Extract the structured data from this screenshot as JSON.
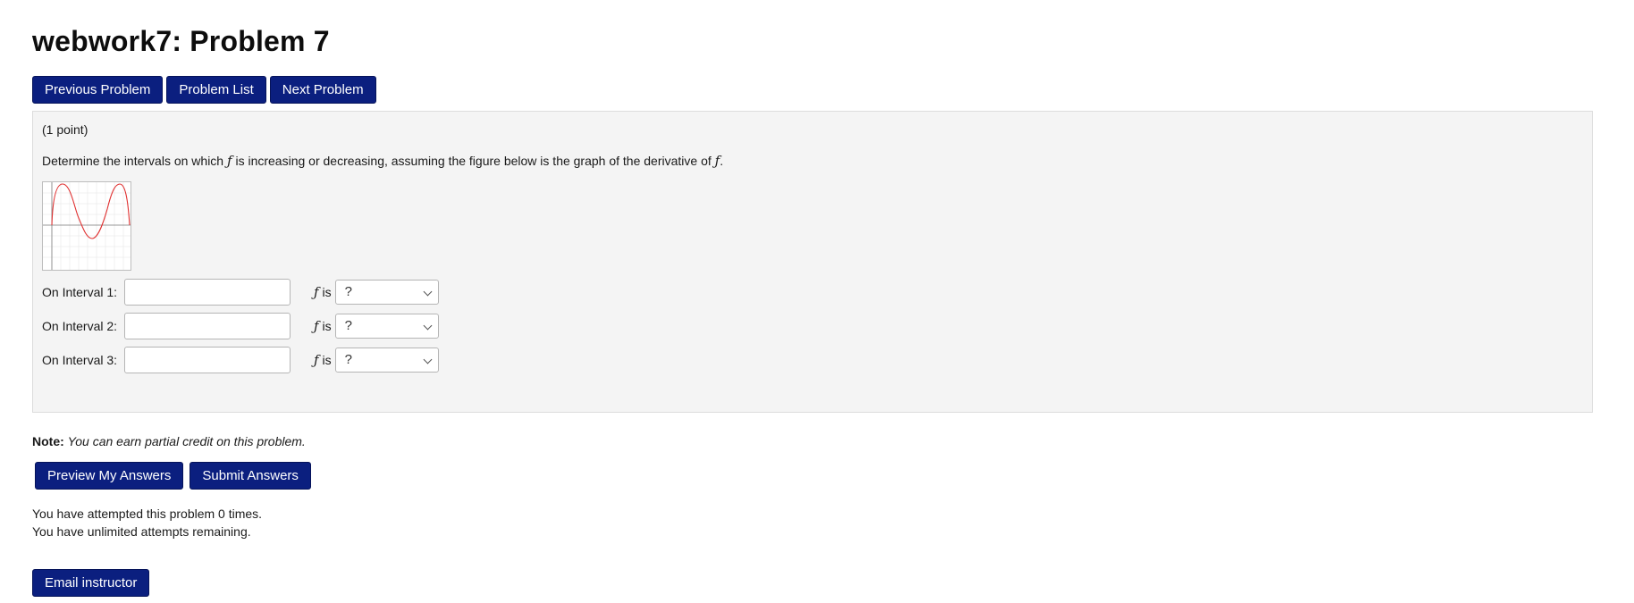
{
  "page": {
    "title": "webwork7: Problem 7"
  },
  "nav": {
    "previous": "Previous Problem",
    "list": "Problem List",
    "next": "Next Problem"
  },
  "problem": {
    "points": "(1 point)",
    "question_pre": "Determine the intervals on which ",
    "question_mid": " is increasing or decreasing, assuming the figure below is the graph of the derivative of ",
    "question_end": ".",
    "f_symbol": "ƒ",
    "f_is": "is",
    "graph_icon": "derivative-graph",
    "curve_color": "#e03030",
    "intervals": [
      {
        "label": "On Interval 1:",
        "value": "",
        "select": "?"
      },
      {
        "label": "On Interval 2:",
        "value": "",
        "select": "?"
      },
      {
        "label": "On Interval 3:",
        "value": "",
        "select": "?"
      }
    ]
  },
  "note": {
    "label": "Note:",
    "text": "You can earn partial credit on this problem."
  },
  "actions": {
    "preview": "Preview My Answers",
    "submit": "Submit Answers"
  },
  "attempts": {
    "line1": "You have attempted this problem 0 times.",
    "line2": "You have unlimited attempts remaining."
  },
  "email": {
    "label": "Email instructor"
  },
  "colors": {
    "button_bg": "#0b1f7f",
    "panel_bg": "#f4f4f4"
  }
}
